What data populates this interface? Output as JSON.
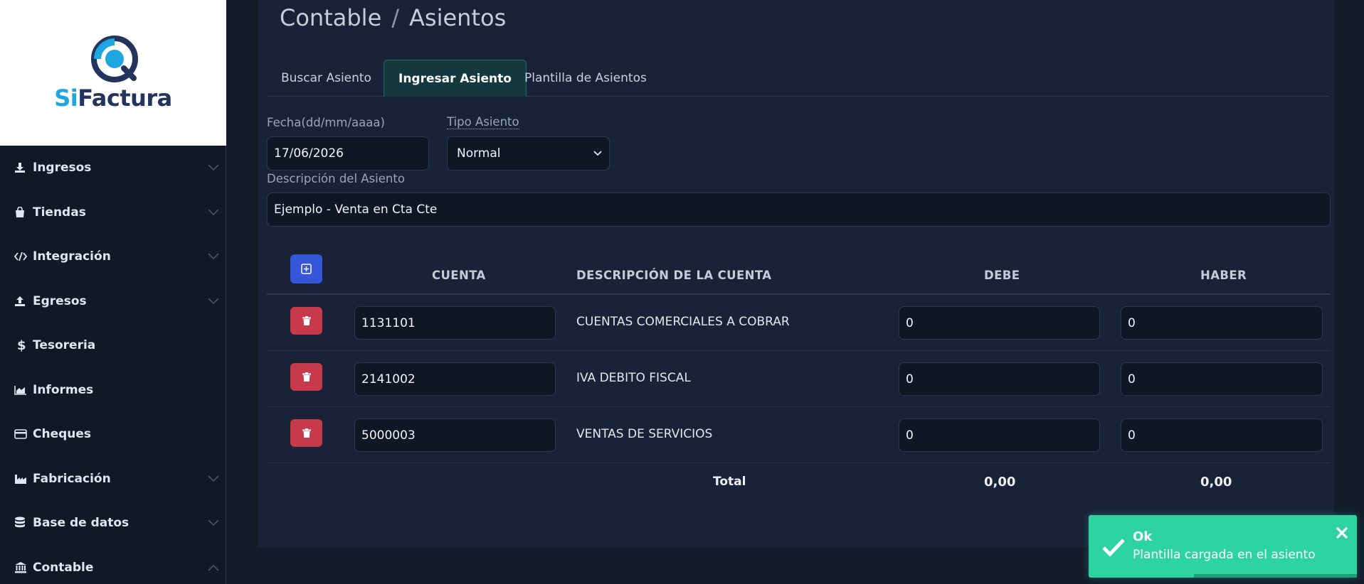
{
  "brand": {
    "prefix": "Si",
    "suffix": "Factura"
  },
  "sidebar": {
    "items": [
      {
        "label": "Ingresos",
        "icon": "download-icon",
        "expandable": true
      },
      {
        "label": "Tiendas",
        "icon": "shopping-bag-icon",
        "expandable": true
      },
      {
        "label": "Integración",
        "icon": "code-icon",
        "expandable": true
      },
      {
        "label": "Egresos",
        "icon": "upload-icon",
        "expandable": true
      },
      {
        "label": "Tesoreria",
        "icon": "dollar-icon",
        "expandable": false
      },
      {
        "label": "Informes",
        "icon": "area-chart-icon",
        "expandable": false
      },
      {
        "label": "Cheques",
        "icon": "credit-card-icon",
        "expandable": false
      },
      {
        "label": "Fabricación",
        "icon": "industry-icon",
        "expandable": true
      },
      {
        "label": "Base de datos",
        "icon": "database-icon",
        "expandable": true
      },
      {
        "label": "Contable",
        "icon": "bank-icon",
        "expandable": true,
        "expanded": true
      }
    ]
  },
  "breadcrumb": {
    "section": "Contable",
    "separator": "/",
    "page": "Asientos"
  },
  "tabs": [
    {
      "label": "Buscar Asiento",
      "active": false
    },
    {
      "label": "Ingresar Asiento",
      "active": true
    },
    {
      "label": "Plantilla de Asientos",
      "active": false
    }
  ],
  "form": {
    "fecha_label": "Fecha(dd/mm/aaaa)",
    "fecha_value": "17/06/2026",
    "tipo_label": "Tipo Asiento",
    "tipo_value": "Normal",
    "descripcion_label": "Descripción del Asiento",
    "descripcion_value": "Ejemplo - Venta en Cta Cte"
  },
  "table": {
    "headers": {
      "cuenta": "CUENTA",
      "descripcion": "DESCRIPCIÓN DE LA CUENTA",
      "debe": "DEBE",
      "haber": "HABER"
    },
    "rows": [
      {
        "cuenta": "1131101",
        "descripcion": "CUENTAS COMERCIALES A COBRAR",
        "debe": "0",
        "haber": "0"
      },
      {
        "cuenta": "2141002",
        "descripcion": "IVA DEBITO FISCAL",
        "debe": "0",
        "haber": "0"
      },
      {
        "cuenta": "5000003",
        "descripcion": "VENTAS DE SERVICIOS",
        "debe": "0",
        "haber": "0"
      }
    ],
    "footer": {
      "total_label": "Total",
      "debe_total": "0,00",
      "haber_total": "0,00"
    }
  },
  "toast": {
    "title": "Ok",
    "message": "Plantilla cargada en el asiento",
    "color": "#2dd4a1"
  },
  "colors": {
    "accent": "#3556d8",
    "danger": "#c63a4b",
    "active_tab": "#13393f",
    "background": "#141c2b"
  }
}
